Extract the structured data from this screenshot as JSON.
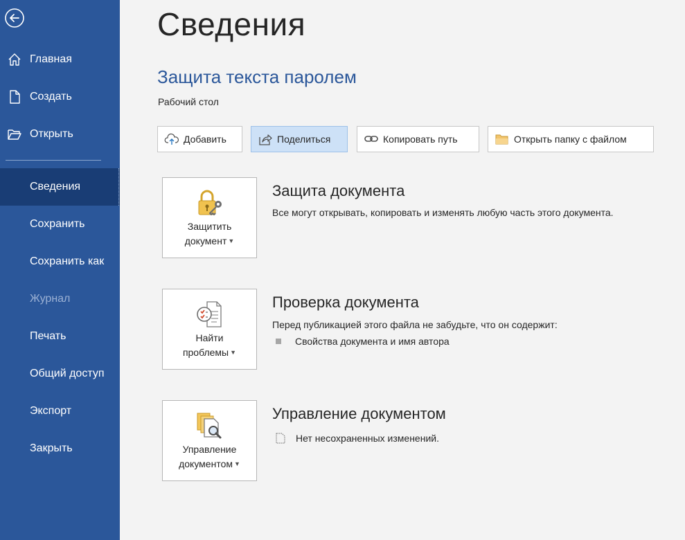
{
  "sidebar": {
    "items": [
      {
        "label": "Главная",
        "icon": "home-icon"
      },
      {
        "label": "Создать",
        "icon": "new-document-icon"
      },
      {
        "label": "Открыть",
        "icon": "open-folder-icon"
      },
      {
        "label": "Сведения",
        "active": true
      },
      {
        "label": "Сохранить"
      },
      {
        "label": "Сохранить как"
      },
      {
        "label": "Журнал",
        "disabled": true
      },
      {
        "label": "Печать"
      },
      {
        "label": "Общий доступ"
      },
      {
        "label": "Экспорт"
      },
      {
        "label": "Закрыть"
      }
    ]
  },
  "main": {
    "title": "Сведения",
    "doc_name": "Защита текста паролем",
    "doc_location": "Рабочий стол",
    "actions": [
      {
        "label": "Добавить",
        "icon": "cloud-upload-icon"
      },
      {
        "label": "Поделиться",
        "icon": "share-icon"
      },
      {
        "label": "Копировать путь",
        "icon": "link-icon"
      },
      {
        "label": "Открыть папку с файлом",
        "icon": "folder-icon"
      }
    ],
    "sections": [
      {
        "tile_line1": "Защитить",
        "tile_line2": "документ",
        "tile_icon": "lock-key-icon",
        "title": "Защита документа",
        "desc": "Все могут открывать, копировать и изменять любую часть этого документа."
      },
      {
        "tile_line1": "Найти",
        "tile_line2": "проблемы",
        "tile_icon": "inspect-document-icon",
        "title": "Проверка документа",
        "desc": "Перед публикацией этого файла не забудьте, что он содержит:",
        "bullet": "Свойства документа и имя автора"
      },
      {
        "tile_line1": "Управление",
        "tile_line2": "документом",
        "tile_icon": "manage-document-icon",
        "title": "Управление документом",
        "bullet": "Нет несохраненных изменений."
      }
    ]
  },
  "colors": {
    "sidebar_bg": "#2b579a",
    "sidebar_active": "#193d75",
    "accent_text": "#2b579a",
    "share_highlight": "#cde1f7"
  }
}
